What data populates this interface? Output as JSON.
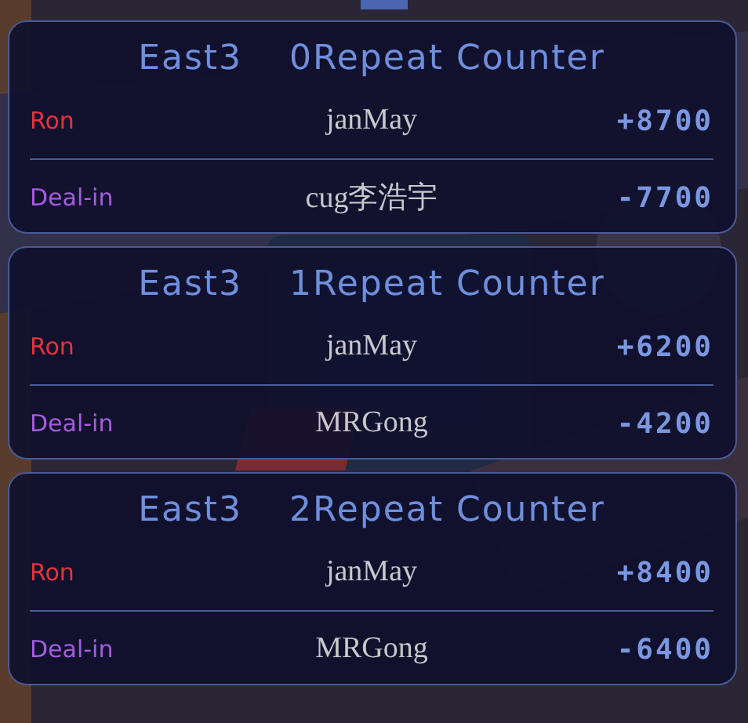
{
  "hands": [
    {
      "round": "East3",
      "counter": "0Repeat Counter",
      "rows": [
        {
          "kind": "ron",
          "label": "Ron",
          "player": "janMay",
          "delta": "+8700"
        },
        {
          "kind": "deal_in",
          "label": "Deal-in",
          "player": "cug李浩宇",
          "delta": "-7700"
        }
      ]
    },
    {
      "round": "East3",
      "counter": "1Repeat Counter",
      "rows": [
        {
          "kind": "ron",
          "label": "Ron",
          "player": "janMay",
          "delta": "+6200"
        },
        {
          "kind": "deal_in",
          "label": "Deal-in",
          "player": "MRGong",
          "delta": "-4200"
        }
      ]
    },
    {
      "round": "East3",
      "counter": "2Repeat Counter",
      "rows": [
        {
          "kind": "ron",
          "label": "Ron",
          "player": "janMay",
          "delta": "+8400"
        },
        {
          "kind": "deal_in",
          "label": "Deal-in",
          "player": "MRGong",
          "delta": "-6400"
        }
      ]
    }
  ]
}
